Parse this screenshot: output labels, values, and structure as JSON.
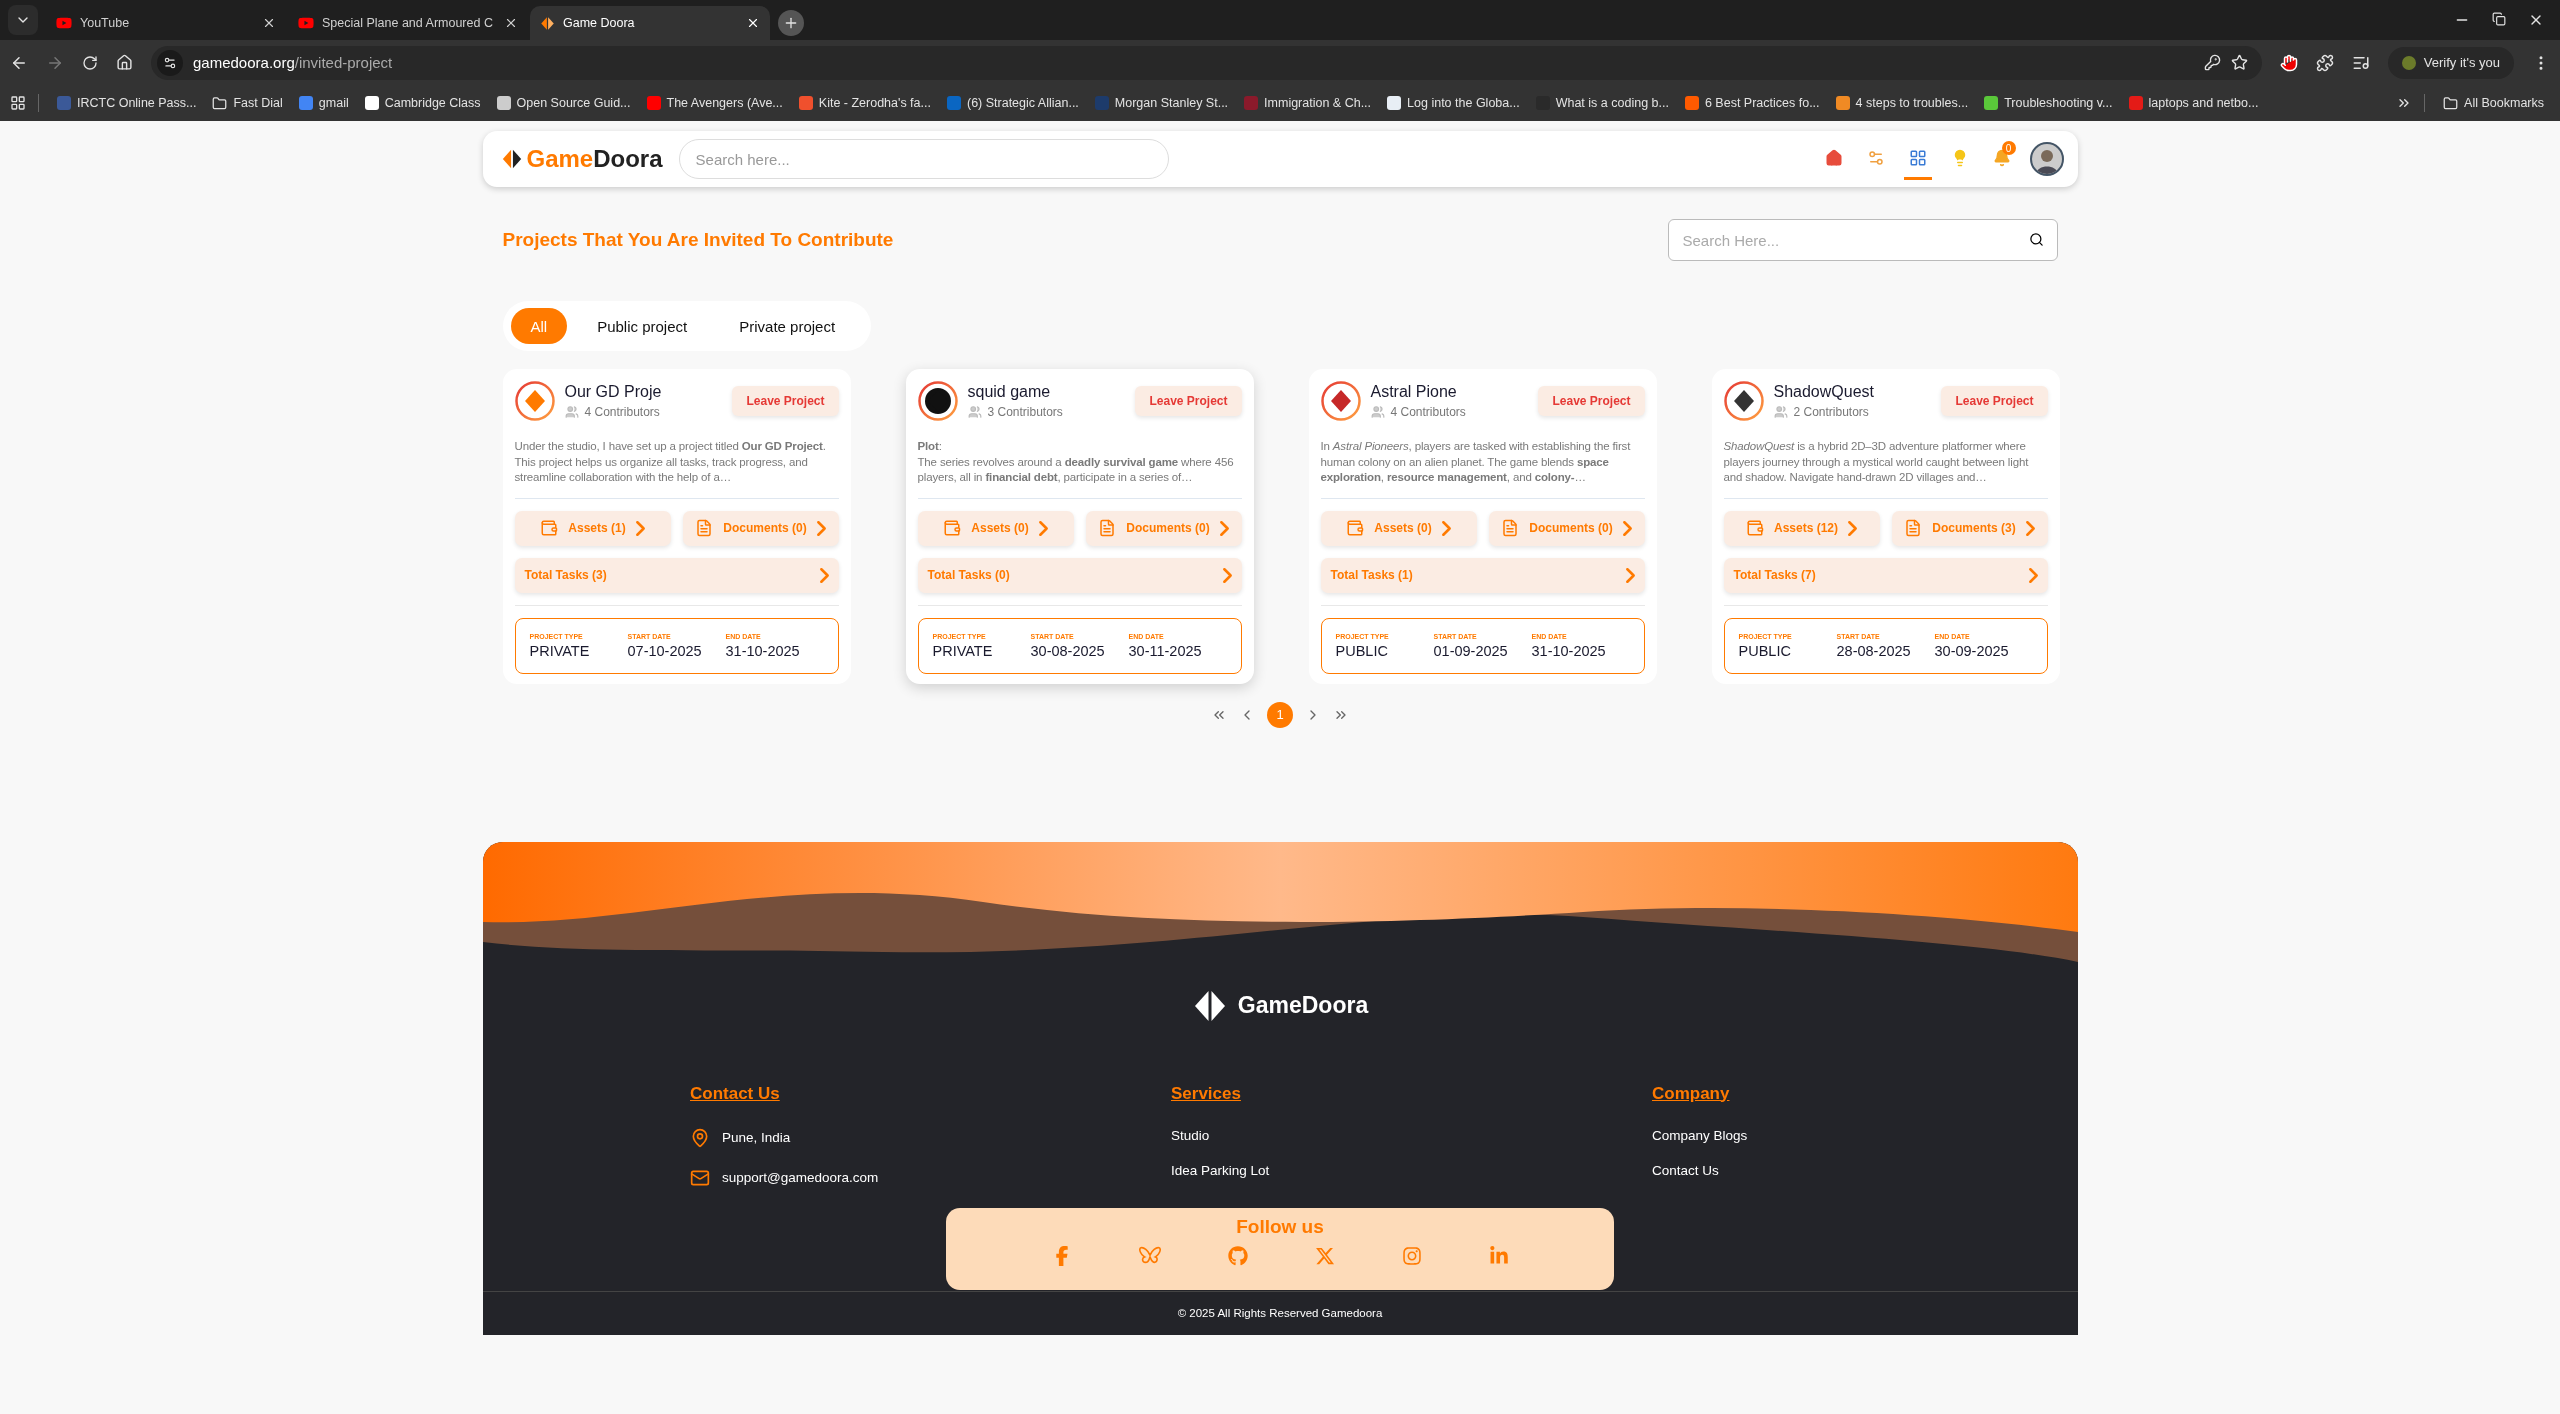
{
  "browser": {
    "tabs": [
      {
        "title": "YouTube",
        "selected": false,
        "kind": "video"
      },
      {
        "title": "Special Plane and Armoured C",
        "selected": false,
        "kind": "video"
      },
      {
        "title": "Game Doora",
        "selected": true,
        "kind": "site"
      }
    ],
    "url": {
      "domain": "gamedoora.org",
      "path": "/invited-project"
    },
    "profile_button": "Verify it's you",
    "bookmarks": [
      {
        "label": "IRCTC Online Pass...",
        "kind": "site",
        "color": "#3b5998"
      },
      {
        "label": "Fast Dial",
        "kind": "folder"
      },
      {
        "label": "gmail",
        "kind": "site",
        "color": "#4285f4"
      },
      {
        "label": "Cambridge Class",
        "kind": "site",
        "color": "#ffffff"
      },
      {
        "label": "Open Source Guid...",
        "kind": "site",
        "color": "#cccccc"
      },
      {
        "label": "The Avengers (Ave...",
        "kind": "site",
        "color": "#ff0000"
      },
      {
        "label": "Kite - Zerodha's fa...",
        "kind": "site",
        "color": "#f0502d"
      },
      {
        "label": "(6) Strategic Allian...",
        "kind": "site",
        "color": "#0a66c2"
      },
      {
        "label": "Morgan Stanley St...",
        "kind": "site",
        "color": "#1d3b6b"
      },
      {
        "label": "Immigration & Ch...",
        "kind": "site",
        "color": "#8b1a2b"
      },
      {
        "label": "Log into the Globa...",
        "kind": "site",
        "color": "#e8eef5"
      },
      {
        "label": "What is a coding b...",
        "kind": "site",
        "color": "#2a2a2a"
      },
      {
        "label": "6 Best Practices fo...",
        "kind": "site",
        "color": "#ff5a00"
      },
      {
        "label": "4 steps to troubles...",
        "kind": "site",
        "color": "#f08a24"
      },
      {
        "label": "Troubleshooting v...",
        "kind": "site",
        "color": "#5ac83a"
      },
      {
        "label": "laptops and netbo...",
        "kind": "site",
        "color": "#e41b17"
      }
    ],
    "all_bookmarks": "All Bookmarks"
  },
  "header": {
    "logo": {
      "first": "Game",
      "second": "Doora"
    },
    "search_placeholder": "Search here...",
    "nav": [
      {
        "selected": false
      },
      {
        "selected": false
      },
      {
        "selected": true
      },
      {
        "selected": false
      }
    ],
    "notification_count": "0"
  },
  "page_title": "Projects That You Are Invited To Contribute",
  "project_search_placeholder": "Search Here...",
  "filters": [
    {
      "label": "All",
      "selected": true
    },
    {
      "label": "Public project",
      "selected": false
    },
    {
      "label": "Private project",
      "selected": false
    }
  ],
  "projects": [
    {
      "name": "Our GD Proje",
      "contributors": "4 Contributors",
      "leave": "Leave Project",
      "hovered": false,
      "description": [
        "Under the studio, I have set up a project titled **Our GD Project**. This project helps us organize all tasks, track progress, and streamline collaboration with the help of a…"
      ],
      "assets": "Assets (1)",
      "documents": "Documents (0)",
      "tasks": "Total Tasks (3)",
      "info": [
        {
          "label": "PROJECT TYPE",
          "value": "PRIVATE"
        },
        {
          "label": "START DATE",
          "value": "07-10-2025"
        },
        {
          "label": "END DATE",
          "value": "31-10-2025"
        }
      ]
    },
    {
      "name": "squid game",
      "contributors": "3 Contributors",
      "leave": "Leave Project",
      "hovered": true,
      "description": [
        "**Plot**:",
        "The series revolves around a **deadly survival game** where 456 players, all in **financial debt**, participate in a series of…"
      ],
      "assets": "Assets (0)",
      "documents": "Documents (0)",
      "tasks": "Total Tasks (0)",
      "info": [
        {
          "label": "PROJECT TYPE",
          "value": "PRIVATE"
        },
        {
          "label": "START DATE",
          "value": "30-08-2025"
        },
        {
          "label": "END DATE",
          "value": "30-11-2025"
        }
      ]
    },
    {
      "name": "Astral Pione",
      "contributors": "4 Contributors",
      "leave": "Leave Project",
      "hovered": false,
      "description": [
        "In *Astral Pioneers*, players are tasked with establishing the first human colony on an alien planet. The game blends **space exploration**, **resource management**, and **colony-**…"
      ],
      "assets": "Assets (0)",
      "documents": "Documents (0)",
      "tasks": "Total Tasks (1)",
      "info": [
        {
          "label": "PROJECT TYPE",
          "value": "PUBLIC"
        },
        {
          "label": "START DATE",
          "value": "01-09-2025"
        },
        {
          "label": "END DATE",
          "value": "31-10-2025"
        }
      ]
    },
    {
      "name": "ShadowQuest",
      "contributors": "2 Contributors",
      "leave": "Leave Project",
      "hovered": false,
      "description": [
        "*ShadowQuest* is a hybrid 2D–3D adventure platformer where players journey through a mystical world caught between light and shadow. Navigate hand-drawn 2D villages and…"
      ],
      "assets": "Assets (12)",
      "documents": "Documents (3)",
      "tasks": "Total Tasks (7)",
      "info": [
        {
          "label": "PROJECT TYPE",
          "value": "PUBLIC"
        },
        {
          "label": "START DATE",
          "value": "28-08-2025"
        },
        {
          "label": "END DATE",
          "value": "30-09-2025"
        }
      ]
    }
  ],
  "pagination": {
    "pages": [
      {
        "label": "1",
        "selected": true
      }
    ]
  },
  "footer": {
    "logo": "GameDoora",
    "columns": [
      {
        "title": "Contact Us",
        "items": [
          {
            "label": "Pune, India",
            "kind": "location"
          },
          {
            "label": "support@gamedoora.com",
            "kind": "email"
          }
        ]
      },
      {
        "title": "Services",
        "items": [
          {
            "label": "Studio",
            "kind": "link"
          },
          {
            "label": "Idea Parking Lot",
            "kind": "link"
          }
        ]
      },
      {
        "title": "Company",
        "items": [
          {
            "label": "Company Blogs",
            "kind": "link"
          },
          {
            "label": "Contact Us",
            "kind": "link"
          }
        ]
      }
    ],
    "follow_title": "Follow us",
    "copyright": "© 2025 All Rights Reserved Gamedoora"
  }
}
